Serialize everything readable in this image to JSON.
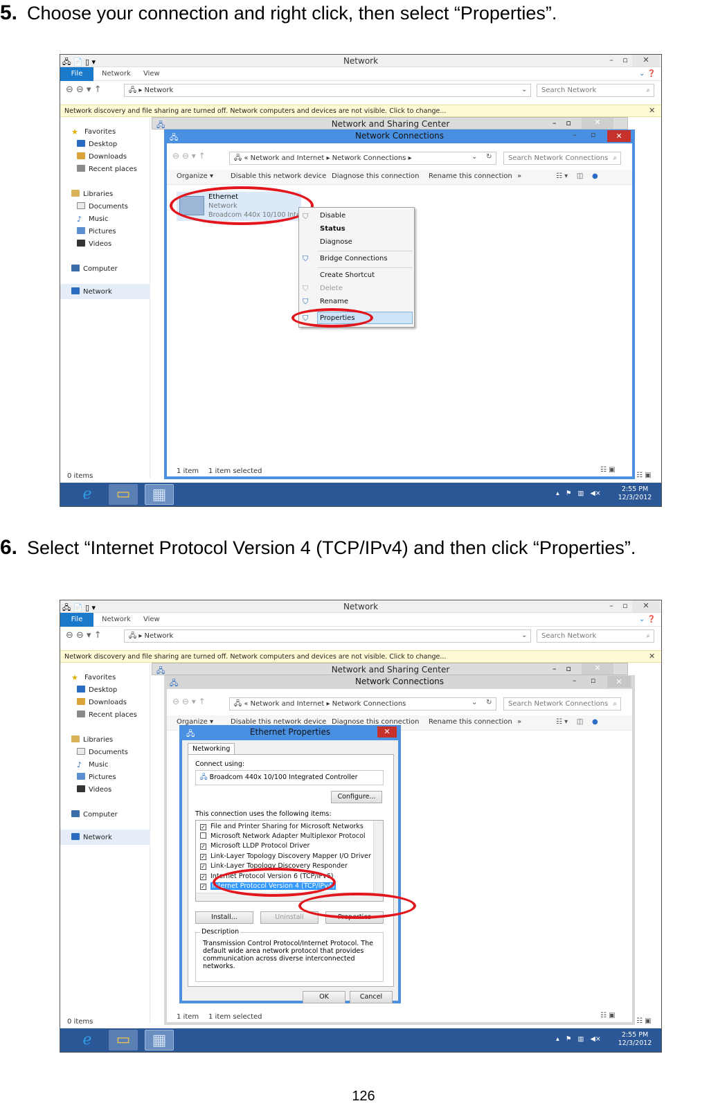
{
  "step5": {
    "number": "5.",
    "text": "Choose your connection and right click, then select “Properties”."
  },
  "step6": {
    "number": "6.",
    "text": "Select “Internet Protocol Version 4 (TCP/IPv4) and then click “Properties”."
  },
  "page_number": "126",
  "explorer": {
    "title": "Network",
    "tabs": [
      "File",
      "Network",
      "View"
    ],
    "breadcrumb": "Network",
    "search_placeholder": "Search Network",
    "notice": "Network discovery and file sharing are turned off. Network computers and devices are not visible. Click to change...",
    "nav": {
      "favorites": "Favorites",
      "desktop": "Desktop",
      "downloads": "Downloads",
      "recent": "Recent places",
      "libraries": "Libraries",
      "documents": "Documents",
      "music": "Music",
      "pictures": "Pictures",
      "videos": "Videos",
      "computer": "Computer",
      "network": "Network"
    },
    "status": "0 items"
  },
  "nsc_title": "Network and Sharing Center",
  "nc": {
    "title": "Network Connections",
    "breadcrumb": "Network and Internet",
    "breadcrumb2": "Network Connections",
    "search_placeholder": "Search Network Connections",
    "toolbar": {
      "organize": "Organize",
      "disable": "Disable this network device",
      "diagnose": "Diagnose this connection",
      "rename": "Rename this connection",
      "more": "»"
    },
    "adapter": {
      "name": "Ethernet",
      "status": "Network",
      "device": "Broadcom 440x 10/100 Integ"
    },
    "status_items": "1 item",
    "status_selected": "1 item selected"
  },
  "context_menu": [
    "Disable",
    "Status",
    "Diagnose",
    "Bridge Connections",
    "Create Shortcut",
    "Delete",
    "Rename",
    "Properties"
  ],
  "tray": {
    "time": "2:55 PM",
    "date": "12/3/2012"
  },
  "props": {
    "title": "Ethernet Properties",
    "tab": "Networking",
    "connect_using_label": "Connect using:",
    "adapter": "Broadcom 440x 10/100 Integrated Controller",
    "configure": "Configure...",
    "items_label": "This connection uses the following items:",
    "items": [
      {
        "label": "File and Printer Sharing for Microsoft Networks",
        "checked": true
      },
      {
        "label": "Microsoft Network Adapter Multiplexor Protocol",
        "checked": false
      },
      {
        "label": "Microsoft LLDP Protocol Driver",
        "checked": true
      },
      {
        "label": "Link-Layer Topology Discovery Mapper I/O Driver",
        "checked": true
      },
      {
        "label": "Link-Layer Topology Discovery Responder",
        "checked": true
      },
      {
        "label": "Internet Protocol Version 6 (TCP/IPv6)",
        "checked": true
      },
      {
        "label": "Internet Protocol Version 4 (TCP/IPv4)",
        "checked": true
      }
    ],
    "install": "Install...",
    "uninstall": "Uninstall",
    "properties": "Properties",
    "description_label": "Description",
    "description": "Transmission Control Protocol/Internet Protocol. The default wide area network protocol that provides communication across diverse interconnected networks.",
    "ok": "OK",
    "cancel": "Cancel"
  }
}
